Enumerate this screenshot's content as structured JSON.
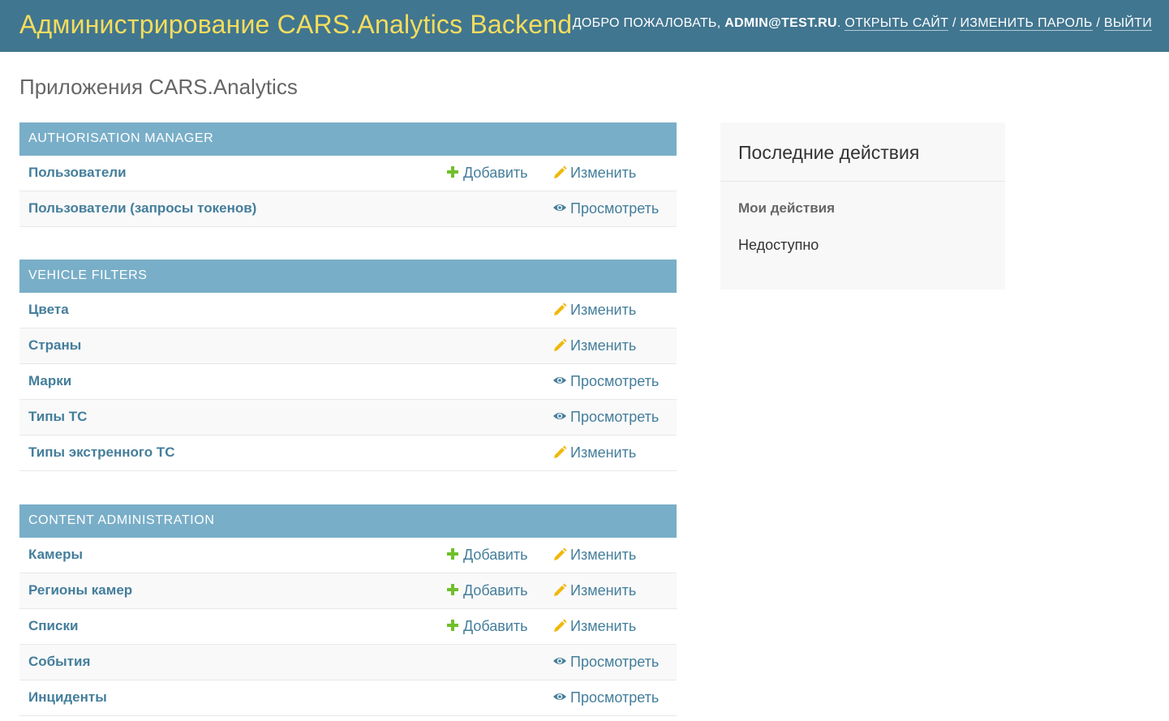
{
  "header": {
    "branding": "Администрирование CARS.Analytics Backend",
    "welcome": "Добро пожаловать,",
    "user": "admin@test.ru",
    "view_site": "Открыть сайт",
    "change_password": "Изменить пароль",
    "logout": "Выйти",
    "separator": "/"
  },
  "page": {
    "title": "Приложения CARS.Analytics"
  },
  "colors": {
    "header_bg": "#417690",
    "branding": "#f5dd5d",
    "caption_bg": "#79aec8",
    "link": "#447e9b",
    "add_icon": "#70bf2b",
    "change_icon": "#efb80b"
  },
  "modules": [
    {
      "caption": "Authorisation manager",
      "models": [
        {
          "name": "Пользователи",
          "add": "Добавить",
          "change": "Изменить"
        },
        {
          "name": "Пользователи (запросы токенов)",
          "view": "Просмотреть"
        }
      ]
    },
    {
      "caption": "Vehicle Filters",
      "models": [
        {
          "name": "Цвета",
          "change": "Изменить"
        },
        {
          "name": "Страны",
          "change": "Изменить"
        },
        {
          "name": "Марки",
          "view": "Просмотреть"
        },
        {
          "name": "Типы ТС",
          "view": "Просмотреть"
        },
        {
          "name": "Типы экстренного ТС",
          "change": "Изменить"
        }
      ]
    },
    {
      "caption": "Content Administration",
      "models": [
        {
          "name": "Камеры",
          "add": "Добавить",
          "change": "Изменить"
        },
        {
          "name": "Регионы камер",
          "add": "Добавить",
          "change": "Изменить"
        },
        {
          "name": "Списки",
          "add": "Добавить",
          "change": "Изменить"
        },
        {
          "name": "События",
          "view": "Просмотреть"
        },
        {
          "name": "Инциденты",
          "view": "Просмотреть"
        }
      ]
    }
  ],
  "recent_actions": {
    "title": "Последние действия",
    "subtitle": "Мои действия",
    "empty": "Недоступно"
  }
}
